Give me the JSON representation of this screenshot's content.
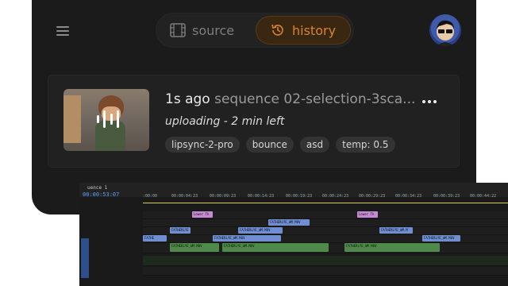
{
  "app": {
    "segmented": {
      "source_label": "source",
      "history_label": "history",
      "active": "history"
    },
    "icons": {
      "menu": "hamburger-icon",
      "source": "film-icon",
      "history": "history-clock-icon",
      "more": "more-dots-icon",
      "processing": "waveform-icon"
    },
    "colors": {
      "accent": "#d9822f",
      "accent_bg": "#3a2712",
      "panel": "#1b1b1b",
      "card": "#212121"
    }
  },
  "job": {
    "age": "1s ago",
    "name": "sequence 02-selection-3sca...",
    "status": "uploading - 2 min left",
    "tags": [
      "lipsync-2-pro",
      "bounce",
      "asd",
      "temp: 0.5"
    ]
  },
  "editor": {
    "sequence_tab": "uence 1",
    "timecode": "00:00:53:07",
    "ruler_ticks": [
      ":00:00",
      "00:00:04:23",
      "00:00:09:23",
      "00:00:14:23",
      "00:00:19:23",
      "00:00:24:23",
      "00:00:29:23",
      "00:00:34:23",
      "00:00:39:23",
      "00:00:44:22"
    ],
    "clip_labels": {
      "pink1": "Lower Th",
      "pink2": "Lower Th",
      "blue_a": "FATHERLYE",
      "blue_b": "FATHERLYE_WM.MOV",
      "blue_c": "FATHERLYE_WM.MOV",
      "blue_d": "FATHERLYE_WM.MOV",
      "blue_e": "FATHE",
      "blue_f": "FATHERLYE_WM.M",
      "blue_g": "FATHERLYE_WM.MOV",
      "green_a": "FATHERLYE_WM.MOV",
      "green_b": "FATHERLYE_WM.MOV",
      "green_c": "FATHERLYE_WM.MOV"
    }
  }
}
